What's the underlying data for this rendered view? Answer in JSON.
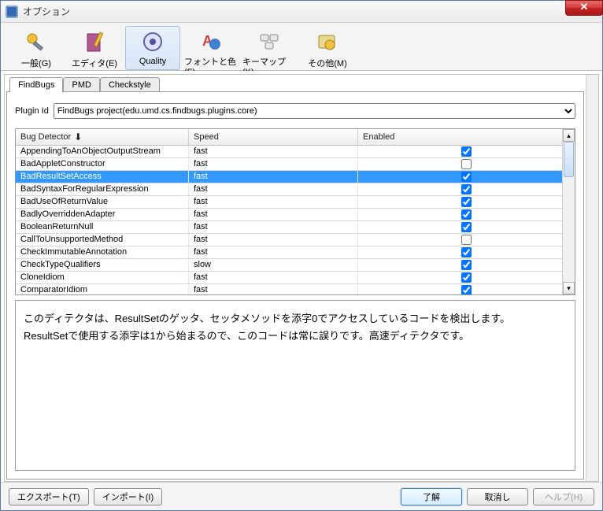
{
  "window": {
    "title": "オプション"
  },
  "toolbar": {
    "items": [
      {
        "label": "一般(G)"
      },
      {
        "label": "エディタ(E)"
      },
      {
        "label": "Quality"
      },
      {
        "label": "フォントと色(F)"
      },
      {
        "label": "キーマップ(K)"
      },
      {
        "label": "その他(M)"
      }
    ],
    "selected_index": 2
  },
  "tabs": {
    "items": [
      "FindBugs",
      "PMD",
      "Checkstyle"
    ],
    "active_index": 0
  },
  "plugin": {
    "label": "Plugin Id",
    "value": "FindBugs project(edu.umd.cs.findbugs.plugins.core)"
  },
  "table": {
    "columns": [
      "Bug Detector",
      "Speed",
      "Enabled"
    ],
    "rows": [
      {
        "detector": "AppendingToAnObjectOutputStream",
        "speed": "fast",
        "enabled": true
      },
      {
        "detector": "BadAppletConstructor",
        "speed": "fast",
        "enabled": false
      },
      {
        "detector": "BadResultSetAccess",
        "speed": "fast",
        "enabled": true,
        "selected": true
      },
      {
        "detector": "BadSyntaxForRegularExpression",
        "speed": "fast",
        "enabled": true
      },
      {
        "detector": "BadUseOfReturnValue",
        "speed": "fast",
        "enabled": true
      },
      {
        "detector": "BadlyOverriddenAdapter",
        "speed": "fast",
        "enabled": true
      },
      {
        "detector": "BooleanReturnNull",
        "speed": "fast",
        "enabled": true
      },
      {
        "detector": "CallToUnsupportedMethod",
        "speed": "fast",
        "enabled": false
      },
      {
        "detector": "CheckImmutableAnnotation",
        "speed": "fast",
        "enabled": true
      },
      {
        "detector": "CheckTypeQualifiers",
        "speed": "slow",
        "enabled": true
      },
      {
        "detector": "CloneIdiom",
        "speed": "fast",
        "enabled": true
      },
      {
        "detector": "ComparatorIdiom",
        "speed": "fast",
        "enabled": true
      }
    ]
  },
  "description": {
    "line1": "このディテクタは、ResultSetのゲッタ、セッタメソッドを添字0でアクセスしているコードを検出します。",
    "line2": "ResultSetで使用する添字は1から始まるので、このコードは常に誤りです。高速ディテクタです。"
  },
  "buttons": {
    "export": "エクスポート(T)",
    "import": "インポート(I)",
    "ok": "了解",
    "cancel": "取消し",
    "help": "ヘルプ(H)"
  }
}
